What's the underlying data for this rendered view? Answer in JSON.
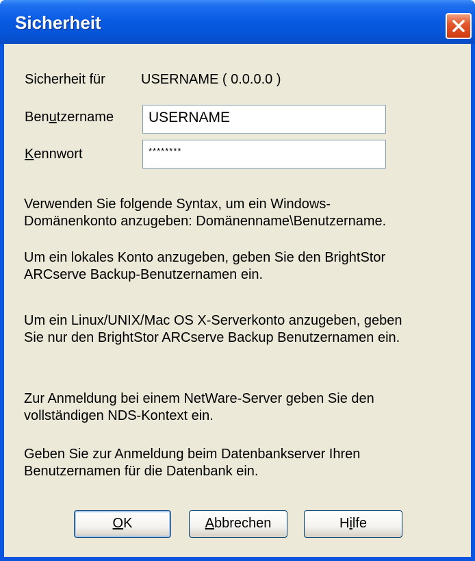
{
  "window": {
    "title": "Sicherheit"
  },
  "security": {
    "label": "Sicherheit für",
    "target": "USERNAME ( 0.0.0.0 )"
  },
  "username": {
    "label_pre": "Ben",
    "label_accel": "u",
    "label_post": "tzername",
    "value": "USERNAME"
  },
  "password": {
    "label_accel": "K",
    "label_post": "ennwort",
    "value": "********"
  },
  "help": {
    "p1_line1": "Verwenden Sie folgende Syntax, um ein Windows-",
    "p1_line2": "Domänenkonto anzugeben: Domänenname\\Benutzername.",
    "p2_line1": "Um ein lokales Konto anzugeben, geben Sie den BrightStor",
    "p2_line2": "ARCserve Backup-Benutzernamen ein.",
    "p3_line1": "Um ein Linux/UNIX/Mac OS X-Serverkonto anzugeben, geben",
    "p3_line2": "Sie nur den BrightStor ARCserve Backup Benutzernamen ein.",
    "p4_line1": "Zur Anmeldung bei einem NetWare-Server geben Sie den",
    "p4_line2": "vollständigen NDS-Kontext ein.",
    "p5_line1": "Geben Sie zur Anmeldung beim Datenbankserver Ihren",
    "p5_line2": "Benutzernamen für die Datenbank ein."
  },
  "buttons": {
    "ok_accel": "O",
    "ok_post": "K",
    "cancel_accel": "A",
    "cancel_post": "bbrechen",
    "help_pre": "H",
    "help_accel": "i",
    "help_post": "lfe"
  },
  "colors": {
    "titlebar": "#0a5ce3",
    "dialog_bg": "#ece9d8",
    "close_button": "#e4572e"
  },
  "icons": {
    "close": "close-icon"
  }
}
